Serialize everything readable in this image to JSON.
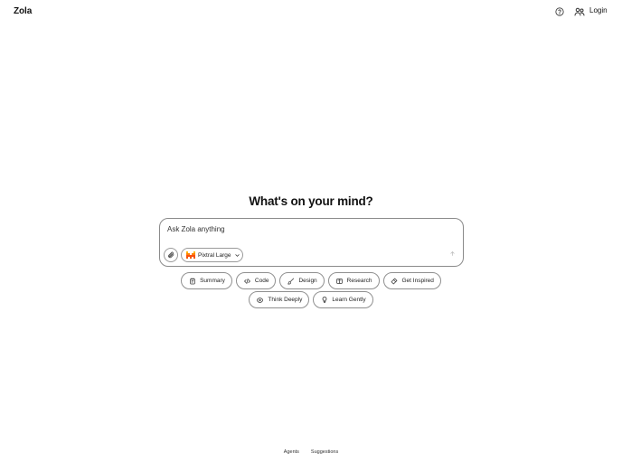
{
  "header": {
    "brand": "Zola",
    "help_icon": "help-circle-icon",
    "agents_icon": "users-icon",
    "login_label": "Login"
  },
  "main": {
    "headline": "What's on your mind?"
  },
  "composer": {
    "placeholder": "Ask Zola anything",
    "value": "",
    "attach_icon": "paperclip-icon",
    "model_label": "Pixtral Large",
    "model_icon": "mistral-logo-icon",
    "send_icon": "arrow-up-icon",
    "colors": {
      "mistral_dark": "#f35b04",
      "mistral_light": "#ffb800"
    }
  },
  "suggestions": {
    "row1": [
      {
        "label": "Summary",
        "icon": "notepad-icon"
      },
      {
        "label": "Code",
        "icon": "code-icon"
      },
      {
        "label": "Design",
        "icon": "paintbrush-icon"
      },
      {
        "label": "Research",
        "icon": "book-open-icon"
      },
      {
        "label": "Get Inspired",
        "icon": "sparkles-icon"
      }
    ],
    "row2": [
      {
        "label": "Think Deeply",
        "icon": "brain-icon"
      },
      {
        "label": "Learn Gently",
        "icon": "lightbulb-icon"
      }
    ]
  },
  "footer": {
    "links": [
      "Agents",
      "Suggestions"
    ]
  }
}
